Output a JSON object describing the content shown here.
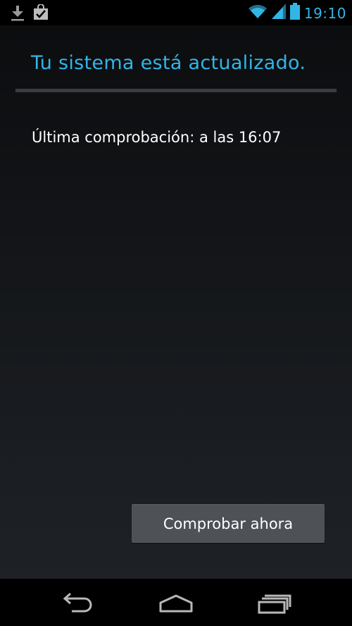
{
  "status_bar": {
    "clock": "19:10",
    "icons": [
      "download-icon",
      "market-bag-check-icon",
      "wifi-icon",
      "signal-icon",
      "battery-icon"
    ],
    "accent_color": "#33b5e5"
  },
  "header": {
    "title": "Tu sistema está actualizado."
  },
  "main": {
    "last_check": "Última comprobación: a las 16:07",
    "check_button_label": "Comprobar ahora"
  },
  "nav_bar": {
    "icons": [
      "back-icon",
      "home-icon",
      "recent-apps-icon"
    ]
  }
}
